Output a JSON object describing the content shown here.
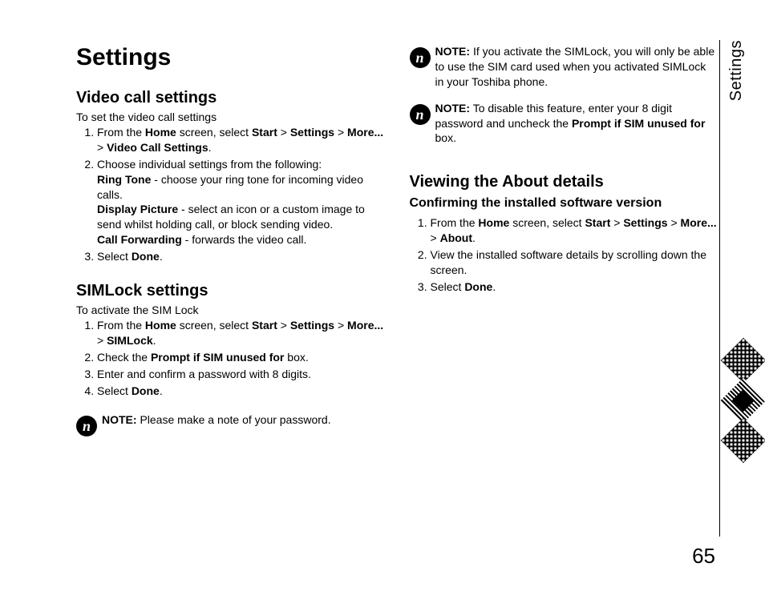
{
  "pageTitle": "Settings",
  "sideTab": "Settings",
  "pageNumber": "65",
  "left": {
    "section1": {
      "heading": "Video call settings",
      "intro": "To set the video call settings",
      "steps": [
        {
          "pre": "From the ",
          "b1": "Home",
          "mid1": " screen, select ",
          "b2": "Start",
          "mid2": " > ",
          "b3": "Settings",
          "mid3": " > ",
          "b4": "More...",
          "mid4": " > ",
          "b5": "Video Call Settings",
          "post": "."
        },
        {
          "text": "Choose individual settings from the following:",
          "subs": [
            {
              "label": "Ring Tone",
              "desc": " - choose your ring tone for incoming video calls."
            },
            {
              "label": "Display Picture",
              "desc": " - select an icon or a custom image to send whilst holding call, or block sending video."
            },
            {
              "label": "Call Forwarding",
              "desc": " - forwards the video call."
            }
          ]
        },
        {
          "pre": "Select ",
          "b1": "Done",
          "post": "."
        }
      ]
    },
    "section2": {
      "heading": "SIMLock settings",
      "intro": "To activate the SIM Lock",
      "steps": [
        {
          "pre": "From the ",
          "b1": "Home",
          "mid1": " screen, select ",
          "b2": "Start",
          "mid2": " > ",
          "b3": "Settings",
          "mid3": " > ",
          "b4": "More...",
          "mid4": " > ",
          "b5": "SIMLock",
          "post": "."
        },
        {
          "pre": "Check the ",
          "b1": "Prompt if SIM unused for",
          "post": " box."
        },
        {
          "text": "Enter and confirm a password with 8 digits."
        },
        {
          "pre": "Select ",
          "b1": "Done",
          "post": "."
        }
      ],
      "note": {
        "label": "NOTE:",
        "text": " Please make a note of your password."
      }
    }
  },
  "right": {
    "note1": {
      "label": "NOTE:",
      "text": " If you activate the SIMLock, you will only be able to use the SIM card used when you activated SIMLock in your Toshiba phone."
    },
    "note2": {
      "label": "NOTE:",
      "pre": " To disable this feature, enter your 8 digit password and uncheck the ",
      "b1": "Prompt if SIM unused for",
      "post": " box."
    },
    "section3": {
      "heading": "Viewing the About details",
      "subheading": "Confirming the installed software version",
      "steps": [
        {
          "pre": "From the ",
          "b1": "Home",
          "mid1": " screen, select ",
          "b2": "Start",
          "mid2": " > ",
          "b3": "Settings",
          "mid3": " > ",
          "b4": "More...",
          "mid4": " > ",
          "b5": "About",
          "post": "."
        },
        {
          "text": "View the installed software details by scrolling down the screen."
        },
        {
          "pre": "Select ",
          "b1": "Done",
          "post": "."
        }
      ]
    }
  }
}
